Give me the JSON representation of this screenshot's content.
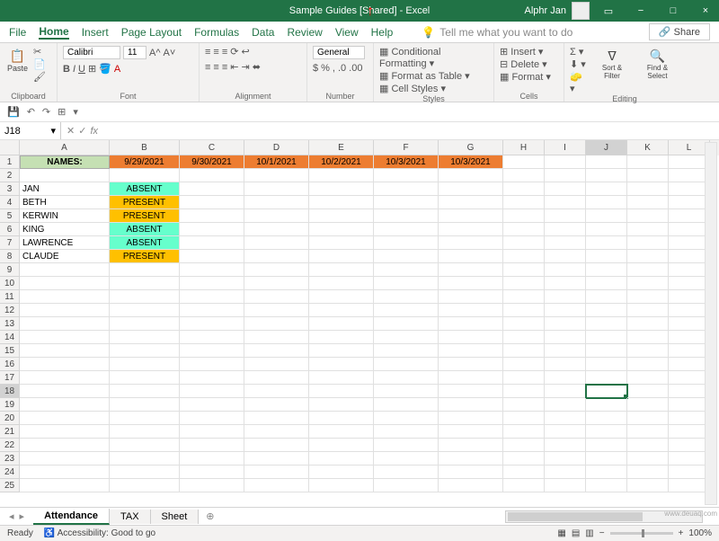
{
  "title": {
    "text": "Sample Guides  [Shared]  -  Excel",
    "user": "Alphr Jan"
  },
  "tabs": {
    "file": "File",
    "home": "Home",
    "insert": "Insert",
    "page_layout": "Page Layout",
    "formulas": "Formulas",
    "data": "Data",
    "review": "Review",
    "view": "View",
    "help": "Help",
    "tellme": "Tell me what you want to do",
    "share": "Share"
  },
  "ribbon": {
    "clipboard": "Clipboard",
    "paste": "Paste",
    "font": "Font",
    "fontname": "Calibri",
    "fontsize": "11",
    "alignment": "Alignment",
    "number": "Number",
    "numfmt": "General",
    "styles": "Styles",
    "cond_fmt": "Conditional Formatting",
    "fmt_table": "Format as Table",
    "cell_styles": "Cell Styles",
    "cells": "Cells",
    "insert": "Insert",
    "delete": "Delete",
    "format": "Format",
    "editing": "Editing",
    "sort_filter": "Sort & Filter",
    "find_select": "Find & Select"
  },
  "fbar": {
    "cell": "J18",
    "fx": "fx"
  },
  "chart_data": {
    "type": "table",
    "columns": [
      "A",
      "B",
      "C",
      "D",
      "E",
      "F",
      "G",
      "H",
      "I",
      "J",
      "K",
      "L"
    ],
    "header_row": {
      "A": "NAMES:",
      "B": "9/29/2021",
      "C": "9/30/2021",
      "D": "10/1/2021",
      "E": "10/2/2021",
      "F": "10/3/2021",
      "G": "10/3/2021"
    },
    "rows": [
      {
        "name": "JAN",
        "status": "ABSENT"
      },
      {
        "name": "BETH",
        "status": "PRESENT"
      },
      {
        "name": "KERWIN",
        "status": "PRESENT"
      },
      {
        "name": "KING",
        "status": "ABSENT"
      },
      {
        "name": "LAWRENCE",
        "status": "ABSENT"
      },
      {
        "name": "CLAUDE",
        "status": "PRESENT"
      }
    ]
  },
  "sheets": {
    "s1": "Attendance",
    "s2": "TAX",
    "s3": "Sheet"
  },
  "status": {
    "ready": "Ready",
    "acc": "Accessibility: Good to go",
    "zoom": "100%"
  },
  "watermark": "www.deuaq.com"
}
